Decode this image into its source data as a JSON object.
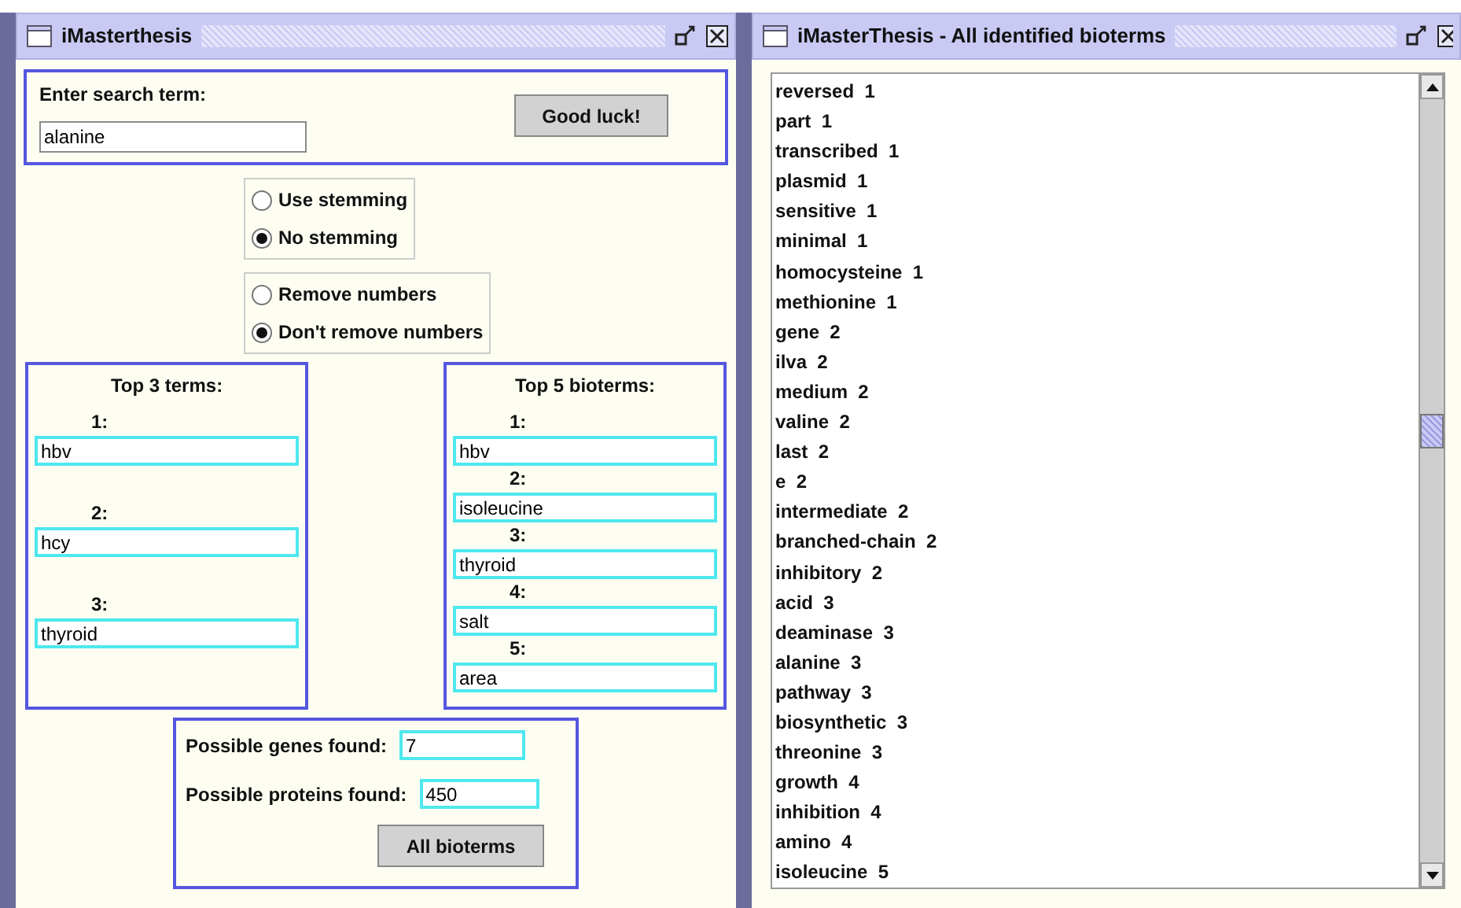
{
  "left_window": {
    "title": "iMasterthesis",
    "search": {
      "label": "Enter search term:",
      "value": "alanine",
      "button": "Good luck!"
    },
    "stemming_options": [
      {
        "label": "Use stemming",
        "selected": false
      },
      {
        "label": "No stemming",
        "selected": true
      }
    ],
    "number_options": [
      {
        "label": "Remove numbers",
        "selected": false
      },
      {
        "label": "Don't remove numbers",
        "selected": true
      }
    ],
    "top_terms": {
      "title": "Top 3 terms:",
      "items": [
        {
          "rank": "1:",
          "value": "hbv"
        },
        {
          "rank": "2:",
          "value": "hcy"
        },
        {
          "rank": "3:",
          "value": "thyroid"
        }
      ]
    },
    "top_bioterms": {
      "title": "Top 5 bioterms:",
      "items": [
        {
          "rank": "1:",
          "value": "hbv"
        },
        {
          "rank": "2:",
          "value": "isoleucine"
        },
        {
          "rank": "3:",
          "value": "thyroid"
        },
        {
          "rank": "4:",
          "value": "salt"
        },
        {
          "rank": "5:",
          "value": "area"
        }
      ]
    },
    "counts": [
      {
        "label": "Possible genes found:",
        "value": "7"
      },
      {
        "label": "Possible proteins found:",
        "value": "450"
      }
    ],
    "all_bioterms_button": "All bioterms"
  },
  "right_window": {
    "title": "iMasterThesis - All identified bioterms",
    "terms": [
      "reversed  1",
      "part  1",
      "transcribed  1",
      "plasmid  1",
      "sensitive  1",
      "minimal  1",
      "homocysteine  1",
      "methionine  1",
      "gene  2",
      "ilva  2",
      "medium  2",
      "valine  2",
      "last  2",
      "e  2",
      "intermediate  2",
      "branched-chain  2",
      "inhibitory  2",
      "acid  3",
      "deaminase  3",
      "alanine  3",
      "pathway  3",
      "biosynthetic  3",
      "threonine  3",
      "growth  4",
      "inhibition  4",
      "amino  4",
      "isoleucine  5"
    ]
  }
}
